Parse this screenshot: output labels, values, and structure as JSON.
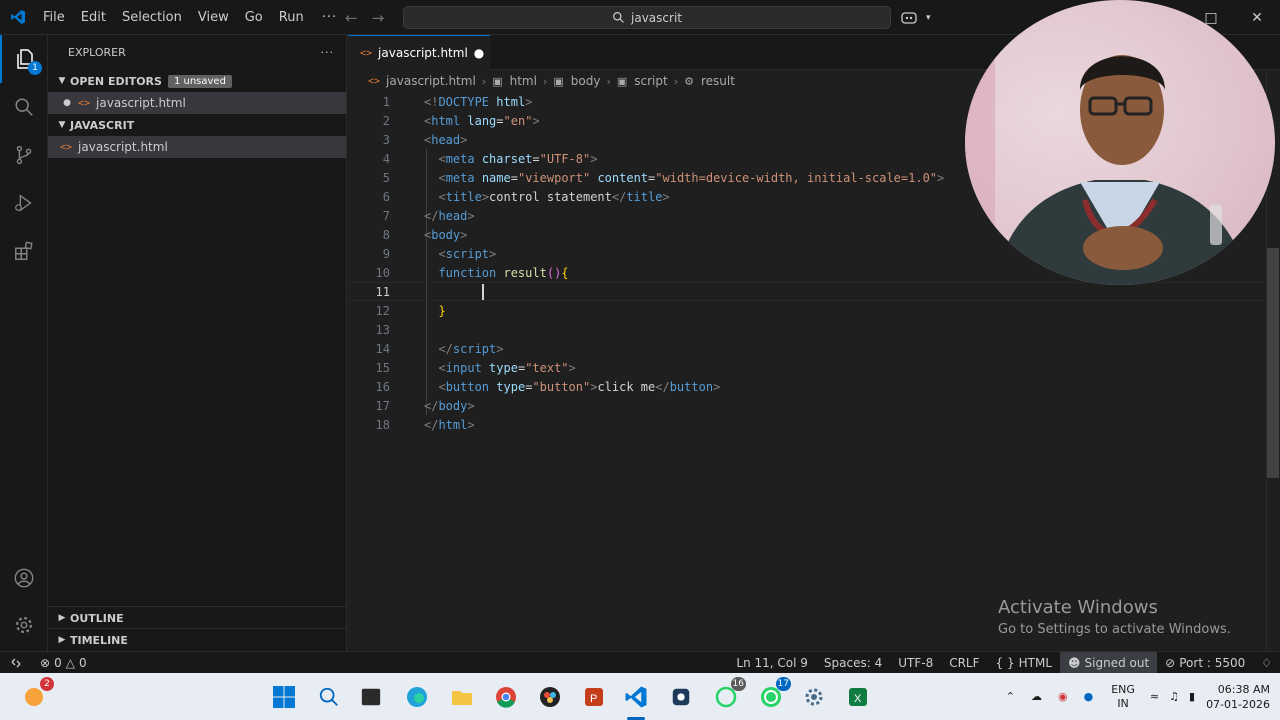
{
  "titlebar": {
    "menu": [
      "File",
      "Edit",
      "Selection",
      "View",
      "Go",
      "Run"
    ],
    "more": "···",
    "search": "javascrit"
  },
  "activity": {
    "explorer_badge": "1"
  },
  "sidebar": {
    "title": "EXPLORER",
    "more": "···",
    "open_editors_label": "OPEN EDITORS",
    "unsaved_badge": "1 unsaved",
    "open_editor_file": "javascript.html",
    "folder_label": "JAVASCRIT",
    "folder_file": "javascript.html",
    "outline_label": "OUTLINE",
    "timeline_label": "TIMELINE"
  },
  "editor": {
    "tab_label": "javascript.html",
    "breadcrumbs": [
      "javascript.html",
      "html",
      "body",
      "script",
      "result"
    ],
    "line_numbers": [
      "1",
      "2",
      "3",
      "4",
      "5",
      "6",
      "7",
      "8",
      "9",
      "10",
      "11",
      "12",
      "13",
      "14",
      "15",
      "16",
      "17",
      "18"
    ],
    "current_line": 11,
    "code": {
      "l1": {
        "open": "<!",
        "name": "DOCTYPE",
        "attr": "html",
        "close": ">"
      },
      "l2": {
        "open": "<",
        "name": "html",
        "attr": "lang",
        "eq": "=",
        "str": "\"en\"",
        "close": ">"
      },
      "l3": {
        "open": "<",
        "name": "head",
        "close": ">"
      },
      "l4": {
        "open": "<",
        "name": "meta",
        "attr": "charset",
        "eq": "=",
        "str": "\"UTF-8\"",
        "close": ">"
      },
      "l5": {
        "open": "<",
        "name": "meta",
        "attr1": "name",
        "eq1": "=",
        "str1": "\"viewport\"",
        "attr2": "content",
        "eq2": "=",
        "str2": "\"width=device-width, initial-scale=1.0\"",
        "close": ">"
      },
      "l6": {
        "open": "<",
        "name": "title",
        "close": ">",
        "text": "control statement",
        "open2": "</",
        "name2": "title",
        "close2": ">"
      },
      "l7": {
        "open": "</",
        "name": "head",
        "close": ">"
      },
      "l8": {
        "open": "<",
        "name": "body",
        "close": ">"
      },
      "l9": {
        "open": "<",
        "name": "script",
        "close": ">"
      },
      "l10": {
        "kw": "function",
        "fn": "result",
        "paren": "()",
        "brace": "{"
      },
      "l12": {
        "brace": "}"
      },
      "l14": {
        "open": "</",
        "name": "script",
        "close": ">"
      },
      "l15": {
        "open": "<",
        "name": "input",
        "attr": "type",
        "eq": "=",
        "str": "\"text\"",
        "close": ">"
      },
      "l16": {
        "open": "<",
        "name": "button",
        "attr": "type",
        "eq": "=",
        "str": "\"button\"",
        "close": ">",
        "text": "click me",
        "open2": "</",
        "name2": "button",
        "close2": ">"
      },
      "l17": {
        "open": "</",
        "name": "body",
        "close": ">"
      },
      "l18": {
        "open": "</",
        "name": "html",
        "close": ">"
      }
    }
  },
  "watermark": {
    "title": "Activate Windows",
    "subtitle": "Go to Settings to activate Windows."
  },
  "statusbar": {
    "errors": "0",
    "warnings": "0",
    "position": "Ln 11, Col 9",
    "spaces": "Spaces: 4",
    "encoding": "UTF-8",
    "eol": "CRLF",
    "language": "HTML",
    "signed": "Signed out",
    "port": "Port : 5500"
  },
  "taskbar": {
    "notif_badge": "2",
    "app_badge_1": "16",
    "app_badge_2": "17",
    "lang_line1": "ENG",
    "lang_line2": "IN",
    "time": "06:38 AM",
    "date": "07-01-2026"
  },
  "colors": {
    "accent": "#0078d4",
    "editor_bg": "#1f1f1f",
    "chrome_bg": "#181818"
  }
}
